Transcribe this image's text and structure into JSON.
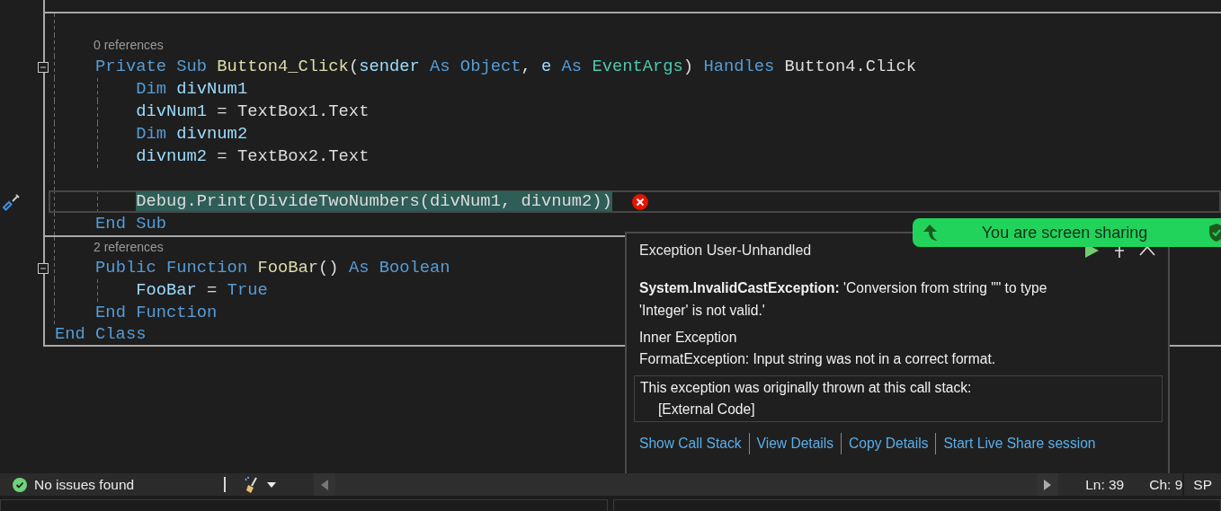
{
  "editor": {
    "lines": [
      {
        "kind": "blank",
        "separator": true
      },
      {
        "kind": "codelens",
        "text": "0 references",
        "separator": false
      },
      {
        "kind": "code",
        "tokens": [
          {
            "text": "    Private Sub ",
            "kind": "keyword"
          },
          {
            "text": "Button4_Click",
            "kind": "function"
          },
          {
            "text": "(",
            "kind": "plain"
          },
          {
            "text": "sender",
            "kind": "variable"
          },
          {
            "text": " As Object",
            "kind": "keyword"
          },
          {
            "text": ", ",
            "kind": "plain"
          },
          {
            "text": "e",
            "kind": "variable"
          },
          {
            "text": " As ",
            "kind": "keyword"
          },
          {
            "text": "EventArgs",
            "kind": "type"
          },
          {
            "text": ") ",
            "kind": "plain"
          },
          {
            "text": "Handles",
            "kind": "keyword"
          },
          {
            "text": " Button4.Click",
            "kind": "plain"
          }
        ],
        "collapsible": true,
        "current": false,
        "highlighted": false,
        "error": false,
        "quick_action": false
      },
      {
        "kind": "code",
        "tokens": [
          {
            "text": "        Dim ",
            "kind": "keyword"
          },
          {
            "text": "divNum1",
            "kind": "variable"
          }
        ],
        "collapsible": false,
        "current": false,
        "highlighted": false,
        "error": false,
        "quick_action": false
      },
      {
        "kind": "code",
        "tokens": [
          {
            "text": "        divNum1",
            "kind": "variable"
          },
          {
            "text": " = TextBox1.Text",
            "kind": "plain"
          }
        ],
        "collapsible": false,
        "current": false,
        "highlighted": false,
        "error": false,
        "quick_action": false
      },
      {
        "kind": "code",
        "tokens": [
          {
            "text": "        Dim ",
            "kind": "keyword"
          },
          {
            "text": "divnum2",
            "kind": "variable"
          }
        ],
        "collapsible": false,
        "current": false,
        "highlighted": false,
        "error": false,
        "quick_action": false
      },
      {
        "kind": "code",
        "tokens": [
          {
            "text": "        divnum2",
            "kind": "variable"
          },
          {
            "text": " = TextBox2.Text",
            "kind": "plain"
          }
        ],
        "collapsible": false,
        "current": false,
        "highlighted": false,
        "error": false,
        "quick_action": false
      },
      {
        "kind": "blank",
        "separator": false
      },
      {
        "kind": "code",
        "tokens": [
          {
            "text": "        Debug.Print(DivideTwoNumbers(divNum1, divnum2))",
            "kind": "plain"
          }
        ],
        "collapsible": false,
        "current": true,
        "highlighted": true,
        "error": true,
        "quick_action": true
      },
      {
        "kind": "code",
        "tokens": [
          {
            "text": "    End Sub",
            "kind": "keyword"
          }
        ],
        "collapsible": false,
        "current": false,
        "highlighted": false,
        "error": false,
        "quick_action": false
      },
      {
        "kind": "codelens",
        "text": "2 references",
        "separator": true
      },
      {
        "kind": "code",
        "tokens": [
          {
            "text": "    Public Function ",
            "kind": "keyword"
          },
          {
            "text": "FooBar",
            "kind": "function"
          },
          {
            "text": "() ",
            "kind": "plain"
          },
          {
            "text": "As Boolean",
            "kind": "keyword"
          }
        ],
        "collapsible": true,
        "current": false,
        "highlighted": false,
        "error": false,
        "quick_action": false
      },
      {
        "kind": "code",
        "tokens": [
          {
            "text": "        FooBar",
            "kind": "variable"
          },
          {
            "text": " = ",
            "kind": "plain"
          },
          {
            "text": "True",
            "kind": "keyword"
          }
        ],
        "collapsible": false,
        "current": false,
        "highlighted": false,
        "error": false,
        "quick_action": false
      },
      {
        "kind": "code",
        "tokens": [
          {
            "text": "    End Function",
            "kind": "keyword"
          }
        ],
        "collapsible": false,
        "current": false,
        "highlighted": false,
        "error": false,
        "quick_action": false
      },
      {
        "kind": "code",
        "tokens": [
          {
            "text": "End Class",
            "kind": "keyword"
          }
        ],
        "collapsible": false,
        "current": false,
        "highlighted": false,
        "error": false,
        "quick_action": false
      }
    ]
  },
  "exception_popup": {
    "title": "Exception User-Unhandled",
    "message": "**System.InvalidCastException:** 'Conversion from string \"\" to type 'Integer' is not valid.'",
    "inner_heading": "Inner Exception",
    "inner_message": "FormatException: Input string was not in a correct format.",
    "call_stack": {
      "heading": "This exception was originally thrown at this call stack:",
      "frames": [
        "[External Code]"
      ]
    },
    "links": [
      "Show Call Stack",
      "View Details",
      "Copy Details",
      "Start Live Share session"
    ]
  },
  "banner": {
    "text": "You are screen sharing"
  },
  "status_bar": {
    "issues": "No issues found",
    "line": "Ln: 39",
    "column": "Ch: 9",
    "encoding": "SP"
  }
}
